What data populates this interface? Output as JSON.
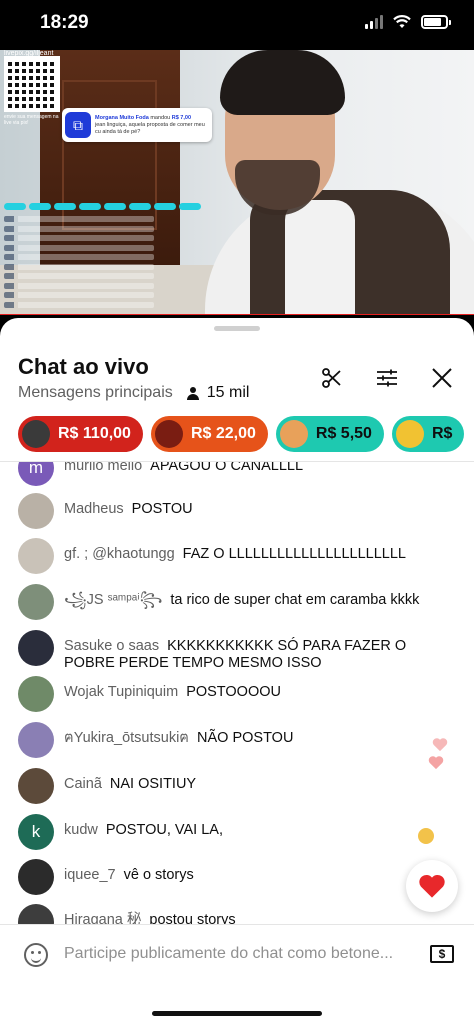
{
  "status_bar": {
    "time": "18:29"
  },
  "video": {
    "qr_url": "livepix.gg/iljeant",
    "qr_caption": "envie sua mensagem na live via pix!",
    "donation": {
      "donor": "Morgana Muito Foda",
      "verb": "mandou",
      "amount": "R$ 7,00",
      "message": "jean linguiça, aquela proposta de comer meu cu ainda tá de pé?"
    }
  },
  "chat": {
    "title": "Chat ao vivo",
    "mode": "Mensagens principais",
    "viewers": "15 mil",
    "chips": [
      {
        "amount": "R$ 110,00",
        "color": "#d2231c"
      },
      {
        "amount": "R$ 22,00",
        "color": "#e6531a"
      },
      {
        "amount": "R$ 5,50",
        "color": "#1ec9b0"
      },
      {
        "amount": "R$",
        "color": "#1ec9b0"
      }
    ],
    "messages": [
      {
        "author": "murilo mello",
        "text": "APAGOU O CANALLLL",
        "avatar_letter": "m",
        "avatar_color": "#7a5ab8"
      },
      {
        "author": "Madheus",
        "text": "POSTOU",
        "avatar_letter": "",
        "avatar_color": "#b9b1a6"
      },
      {
        "author": "gf. ; @khaotungg",
        "text": "FAZ O LLLLLLLLLLLLLLLLLLLLLL",
        "avatar_letter": "",
        "avatar_color": "#c9c2b8"
      },
      {
        "author": "꧁JS ˢᵃᵐᵖᵃⁱ꧂",
        "text": "ta rico de super chat em caramba kkkk",
        "avatar_letter": "",
        "avatar_color": "#7e8f7a"
      },
      {
        "author": "Sasuke o saas",
        "text": "KKKKKKKKKKK SÓ PARA FAZER O POBRE PERDE TEMPO MESMO ISSO",
        "avatar_letter": "",
        "avatar_color": "#2a2d3b"
      },
      {
        "author": "Wojak Tupiniquim",
        "text": "POSTOOOOU",
        "avatar_letter": "",
        "avatar_color": "#6f8a68"
      },
      {
        "author": "ฅYukira_ōtsutsukiฅ",
        "text": "NÃO POSTOU",
        "avatar_letter": "",
        "avatar_color": "#8a7fb4"
      },
      {
        "author": "Cainã",
        "text": "NAI OSITIUY",
        "avatar_letter": "",
        "avatar_color": "#5c4a3a"
      },
      {
        "author": "kudw",
        "text": "POSTOU, VAI LA,",
        "avatar_letter": "k",
        "avatar_color": "#1e6b56"
      },
      {
        "author": "iquee_7",
        "text": "vê o storys",
        "avatar_letter": "",
        "avatar_color": "#2b2b2b"
      },
      {
        "author": "Hiragana 秘",
        "text": "postou storys",
        "avatar_letter": "",
        "avatar_color": "#3d3d3d"
      }
    ],
    "input_placeholder": "Participe publicamente do chat como betone...",
    "super_chat_symbol": "$"
  },
  "icons": [
    "scissors-icon",
    "tune-icon",
    "close-icon",
    "heart-icon",
    "emoji-icon",
    "dollar-icon"
  ]
}
